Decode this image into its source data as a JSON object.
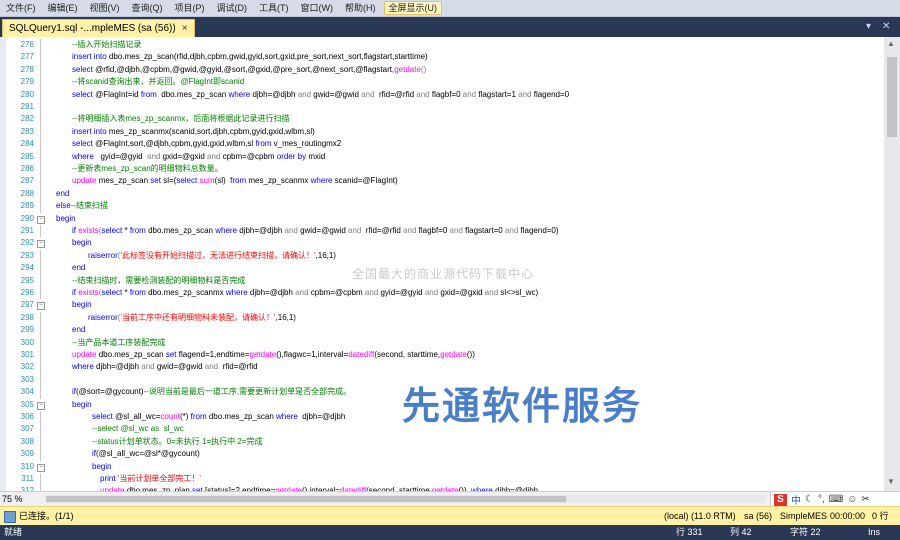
{
  "menubar": {
    "items": [
      "文件(F)",
      "编辑(E)",
      "视图(V)",
      "查询(Q)",
      "项目(P)",
      "调试(D)",
      "工具(T)",
      "窗口(W)",
      "帮助(H)"
    ],
    "fullscreen_label": "全屏显示(U)"
  },
  "tab": {
    "title": "SQLQuery1.sql -...mpleMES (sa (56))",
    "close": "×"
  },
  "code_lines": [
    {
      "n": "276",
      "indent": 72,
      "segs": [
        {
          "t": "--插入开始扫描记录",
          "c": "cm"
        }
      ]
    },
    {
      "n": "277",
      "indent": 72,
      "segs": [
        {
          "t": "insert into ",
          "c": "kw"
        },
        {
          "t": "dbo.mes_zp_scan",
          "c": "plain"
        },
        {
          "t": "(rfid,djbh,cpbm,gwid,gyid,sort,gxid,pre_sort,next_sort,flagstart,starttime)",
          "c": "plain"
        }
      ]
    },
    {
      "n": "278",
      "indent": 72,
      "segs": [
        {
          "t": "select ",
          "c": "kw"
        },
        {
          "t": "@rfid,@djbh,@cpbm,@gwid,@gyid,@sort,@gxid,@pre_sort,@next_sort,@flagstart,",
          "c": "plain"
        },
        {
          "t": "getdate",
          "c": "fn"
        },
        {
          "t": "()",
          "c": "sym"
        }
      ]
    },
    {
      "n": "279",
      "indent": 72,
      "segs": [
        {
          "t": "--将scanid查询出来，并返回。@FlagInt即scanid",
          "c": "cm"
        }
      ]
    },
    {
      "n": "280",
      "indent": 72,
      "segs": [
        {
          "t": "select ",
          "c": "kw"
        },
        {
          "t": "@FlagInt=id ",
          "c": "plain"
        },
        {
          "t": "from ",
          "c": "kw"
        },
        {
          "t": " dbo.mes_zp_scan ",
          "c": "plain"
        },
        {
          "t": "where ",
          "c": "kw"
        },
        {
          "t": "djbh=@djbh ",
          "c": "plain"
        },
        {
          "t": "and ",
          "c": "sym"
        },
        {
          "t": "gwid=@gwid ",
          "c": "plain"
        },
        {
          "t": "and ",
          "c": "sym"
        },
        {
          "t": " rfid=@rfid ",
          "c": "plain"
        },
        {
          "t": "and ",
          "c": "sym"
        },
        {
          "t": "flagbf=0 ",
          "c": "plain"
        },
        {
          "t": "and ",
          "c": "sym"
        },
        {
          "t": "flagstart=1 ",
          "c": "plain"
        },
        {
          "t": "and ",
          "c": "sym"
        },
        {
          "t": "flagend=0",
          "c": "plain"
        }
      ]
    },
    {
      "n": "281",
      "indent": 72,
      "segs": []
    },
    {
      "n": "282",
      "indent": 72,
      "segs": [
        {
          "t": "--将明细插入表mes_zp_scanmx，后面将根据此记录进行扫描",
          "c": "cm"
        }
      ]
    },
    {
      "n": "283",
      "indent": 72,
      "segs": [
        {
          "t": "insert into ",
          "c": "kw"
        },
        {
          "t": "mes_zp_scanmx(scanid,sort,djbh,cpbm,gyid,gxid,wlbm,sl)",
          "c": "plain"
        }
      ]
    },
    {
      "n": "284",
      "indent": 72,
      "segs": [
        {
          "t": "select ",
          "c": "kw"
        },
        {
          "t": "@FlagInt,sort,@djbh,cpbm,gyid,gxid,wlbm,sl ",
          "c": "plain"
        },
        {
          "t": "from ",
          "c": "kw"
        },
        {
          "t": "v_mes_routingmx2",
          "c": "plain"
        }
      ]
    },
    {
      "n": "285",
      "indent": 72,
      "segs": [
        {
          "t": "where ",
          "c": "kw"
        },
        {
          "t": "  gyid=@gyid  ",
          "c": "plain"
        },
        {
          "t": "and ",
          "c": "sym"
        },
        {
          "t": "gxid=@gxid ",
          "c": "plain"
        },
        {
          "t": "and ",
          "c": "sym"
        },
        {
          "t": "cpbm=@cpbm ",
          "c": "plain"
        },
        {
          "t": "order by ",
          "c": "kw"
        },
        {
          "t": "mxid",
          "c": "plain"
        }
      ]
    },
    {
      "n": "286",
      "indent": 72,
      "segs": [
        {
          "t": "--更新表mes_zp_scan的明细物料总数量。",
          "c": "cm"
        }
      ]
    },
    {
      "n": "287",
      "indent": 72,
      "segs": [
        {
          "t": "update ",
          "c": "fn"
        },
        {
          "t": "mes_zp_scan ",
          "c": "plain"
        },
        {
          "t": "set ",
          "c": "kw"
        },
        {
          "t": "sl=(",
          "c": "plain"
        },
        {
          "t": "select ",
          "c": "kw"
        },
        {
          "t": "sum",
          "c": "fn"
        },
        {
          "t": "(sl)  ",
          "c": "plain"
        },
        {
          "t": "from ",
          "c": "kw"
        },
        {
          "t": "mes_zp_scanmx ",
          "c": "plain"
        },
        {
          "t": "where ",
          "c": "kw"
        },
        {
          "t": "scanid=@FlagInt)",
          "c": "plain"
        }
      ]
    },
    {
      "n": "288",
      "indent": 56,
      "segs": [
        {
          "t": "end",
          "c": "kw"
        }
      ]
    },
    {
      "n": "289",
      "indent": 56,
      "segs": [
        {
          "t": "else",
          "c": "kw"
        },
        {
          "t": "--结束扫描",
          "c": "cm"
        }
      ]
    },
    {
      "n": "290",
      "indent": 56,
      "segs": [
        {
          "t": "begin",
          "c": "kw"
        }
      ]
    },
    {
      "n": "291",
      "indent": 72,
      "segs": [
        {
          "t": "if ",
          "c": "kw"
        },
        {
          "t": "exists",
          "c": "fn"
        },
        {
          "t": "(",
          "c": "sym"
        },
        {
          "t": "select ",
          "c": "kw"
        },
        {
          "t": "* ",
          "c": "plain"
        },
        {
          "t": "from ",
          "c": "kw"
        },
        {
          "t": "dbo.mes_zp_scan ",
          "c": "plain"
        },
        {
          "t": "where ",
          "c": "kw"
        },
        {
          "t": "djbh=@djbh ",
          "c": "plain"
        },
        {
          "t": "and ",
          "c": "sym"
        },
        {
          "t": "gwid=@gwid ",
          "c": "plain"
        },
        {
          "t": "and ",
          "c": "sym"
        },
        {
          "t": " rfid=@rfid ",
          "c": "plain"
        },
        {
          "t": "and ",
          "c": "sym"
        },
        {
          "t": "flagbf=0 ",
          "c": "plain"
        },
        {
          "t": "and ",
          "c": "sym"
        },
        {
          "t": "flagstart=0 ",
          "c": "plain"
        },
        {
          "t": "and ",
          "c": "sym"
        },
        {
          "t": "flagend=0)",
          "c": "plain"
        }
      ]
    },
    {
      "n": "292",
      "indent": 72,
      "segs": [
        {
          "t": "begin",
          "c": "kw"
        }
      ]
    },
    {
      "n": "293",
      "indent": 88,
      "segs": [
        {
          "t": "raiserror",
          "c": "kw"
        },
        {
          "t": "(",
          "c": "sym"
        },
        {
          "t": "'此标签没有开始扫描过，无法进行结束扫描，请确认！'",
          "c": "st"
        },
        {
          "t": ",16,1)",
          "c": "plain"
        }
      ]
    },
    {
      "n": "294",
      "indent": 72,
      "segs": [
        {
          "t": "end",
          "c": "kw"
        }
      ]
    },
    {
      "n": "295",
      "indent": 72,
      "segs": [
        {
          "t": "--结束扫描时，需要检测装配的明细物料是否完成",
          "c": "cm"
        }
      ]
    },
    {
      "n": "296",
      "indent": 72,
      "segs": [
        {
          "t": "if ",
          "c": "kw"
        },
        {
          "t": "exists",
          "c": "fn"
        },
        {
          "t": "(",
          "c": "sym"
        },
        {
          "t": "select ",
          "c": "kw"
        },
        {
          "t": "* ",
          "c": "plain"
        },
        {
          "t": "from ",
          "c": "kw"
        },
        {
          "t": "dbo.mes_zp_scanmx ",
          "c": "plain"
        },
        {
          "t": "where ",
          "c": "kw"
        },
        {
          "t": "djbh=@djbh ",
          "c": "plain"
        },
        {
          "t": "and ",
          "c": "sym"
        },
        {
          "t": "cpbm=@cpbm ",
          "c": "plain"
        },
        {
          "t": "and ",
          "c": "sym"
        },
        {
          "t": "gyid=@gyid ",
          "c": "plain"
        },
        {
          "t": "and ",
          "c": "sym"
        },
        {
          "t": "gxid=@gxid ",
          "c": "plain"
        },
        {
          "t": "and ",
          "c": "sym"
        },
        {
          "t": "sl<>sl_wc)",
          "c": "plain"
        }
      ]
    },
    {
      "n": "297",
      "indent": 72,
      "segs": [
        {
          "t": "begin",
          "c": "kw"
        }
      ]
    },
    {
      "n": "298",
      "indent": 88,
      "segs": [
        {
          "t": "raiserror",
          "c": "kw"
        },
        {
          "t": "(",
          "c": "sym"
        },
        {
          "t": "'当前工序中还有明细物料未装配，请确认！'",
          "c": "st"
        },
        {
          "t": ",16,1)",
          "c": "plain"
        }
      ]
    },
    {
      "n": "299",
      "indent": 72,
      "segs": [
        {
          "t": "end",
          "c": "kw"
        }
      ]
    },
    {
      "n": "300",
      "indent": 72,
      "segs": [
        {
          "t": "--当产品本道工序装配完成",
          "c": "cm"
        }
      ]
    },
    {
      "n": "301",
      "indent": 72,
      "segs": [
        {
          "t": "update ",
          "c": "fn"
        },
        {
          "t": "dbo.mes_zp_scan ",
          "c": "plain"
        },
        {
          "t": "set ",
          "c": "kw"
        },
        {
          "t": "flagend=1,endtime=",
          "c": "plain"
        },
        {
          "t": "getdate",
          "c": "fn"
        },
        {
          "t": "(),flagwc=1,interval=",
          "c": "plain"
        },
        {
          "t": "datediff",
          "c": "fn"
        },
        {
          "t": "(second, starttime,",
          "c": "plain"
        },
        {
          "t": "getdate",
          "c": "fn"
        },
        {
          "t": "())",
          "c": "plain"
        }
      ]
    },
    {
      "n": "302",
      "indent": 72,
      "segs": [
        {
          "t": "where ",
          "c": "kw"
        },
        {
          "t": "djbh=@djbh ",
          "c": "plain"
        },
        {
          "t": "and ",
          "c": "sym"
        },
        {
          "t": "gwid=@gwid ",
          "c": "plain"
        },
        {
          "t": "and ",
          "c": "sym"
        },
        {
          "t": " rfid=@rfid",
          "c": "plain"
        }
      ]
    },
    {
      "n": "303",
      "indent": 72,
      "segs": []
    },
    {
      "n": "304",
      "indent": 72,
      "segs": [
        {
          "t": "if",
          "c": "kw"
        },
        {
          "t": "(@sort=@gycount)",
          "c": "plain"
        },
        {
          "t": "--说明当前是最后一道工序,需要更新计划单是否全部完成。",
          "c": "cm"
        }
      ]
    },
    {
      "n": "305",
      "indent": 72,
      "segs": [
        {
          "t": "begin",
          "c": "kw"
        }
      ]
    },
    {
      "n": "306",
      "indent": 92,
      "segs": [
        {
          "t": "select ",
          "c": "kw"
        },
        {
          "t": "@sl_all_wc=",
          "c": "plain"
        },
        {
          "t": "count",
          "c": "fn"
        },
        {
          "t": "(*) ",
          "c": "plain"
        },
        {
          "t": "from ",
          "c": "kw"
        },
        {
          "t": "dbo.mes_zp_scan ",
          "c": "plain"
        },
        {
          "t": "where ",
          "c": "kw"
        },
        {
          "t": " djbh=@djbh",
          "c": "plain"
        }
      ]
    },
    {
      "n": "307",
      "indent": 92,
      "segs": [
        {
          "t": "--select @sl_wc as  sl_wc",
          "c": "cm"
        }
      ]
    },
    {
      "n": "308",
      "indent": 92,
      "segs": [
        {
          "t": "--status计划单状态。0=未执行 1=执行中 2=完成",
          "c": "cm"
        }
      ]
    },
    {
      "n": "309",
      "indent": 92,
      "segs": [
        {
          "t": "if",
          "c": "kw"
        },
        {
          "t": "(@sl_all_wc=@sl*@gycount)",
          "c": "plain"
        }
      ]
    },
    {
      "n": "310",
      "indent": 92,
      "segs": [
        {
          "t": "begin",
          "c": "kw"
        }
      ]
    },
    {
      "n": "311",
      "indent": 100,
      "segs": [
        {
          "t": "print ",
          "c": "kw"
        },
        {
          "t": "'当前计划单全部完工！'",
          "c": "st"
        }
      ]
    },
    {
      "n": "312",
      "indent": 100,
      "segs": [
        {
          "t": "update ",
          "c": "fn"
        },
        {
          "t": "dbo.mes_zp_plan ",
          "c": "plain"
        },
        {
          "t": "set ",
          "c": "kw"
        },
        {
          "t": "[status]=2,endtime=",
          "c": "plain"
        },
        {
          "t": "getdate",
          "c": "fn"
        },
        {
          "t": "(),interval=",
          "c": "plain"
        },
        {
          "t": "datediff",
          "c": "fn"
        },
        {
          "t": "(second, starttime,",
          "c": "plain"
        },
        {
          "t": "getdate",
          "c": "fn"
        },
        {
          "t": "())  ",
          "c": "plain"
        },
        {
          "t": "where ",
          "c": "kw"
        },
        {
          "t": "djbh=@djbh",
          "c": "plain"
        }
      ]
    }
  ],
  "watermark": "全国最大的商业源代码下载中心",
  "brand": "先通软件服务",
  "zoom": "75 %",
  "ime": {
    "logo": "S",
    "lang": "中"
  },
  "status": {
    "connected": "已连接。(1/1)",
    "server": "(local) (11.0 RTM)",
    "user": "sa (56)",
    "db": "SimpleMES",
    "time": "00:00:00",
    "rows": "0 行"
  },
  "bottom": {
    "ready": "就绪",
    "row": "行 331",
    "col": "列 42",
    "ch": "字符 22",
    "mode": "Ins"
  }
}
